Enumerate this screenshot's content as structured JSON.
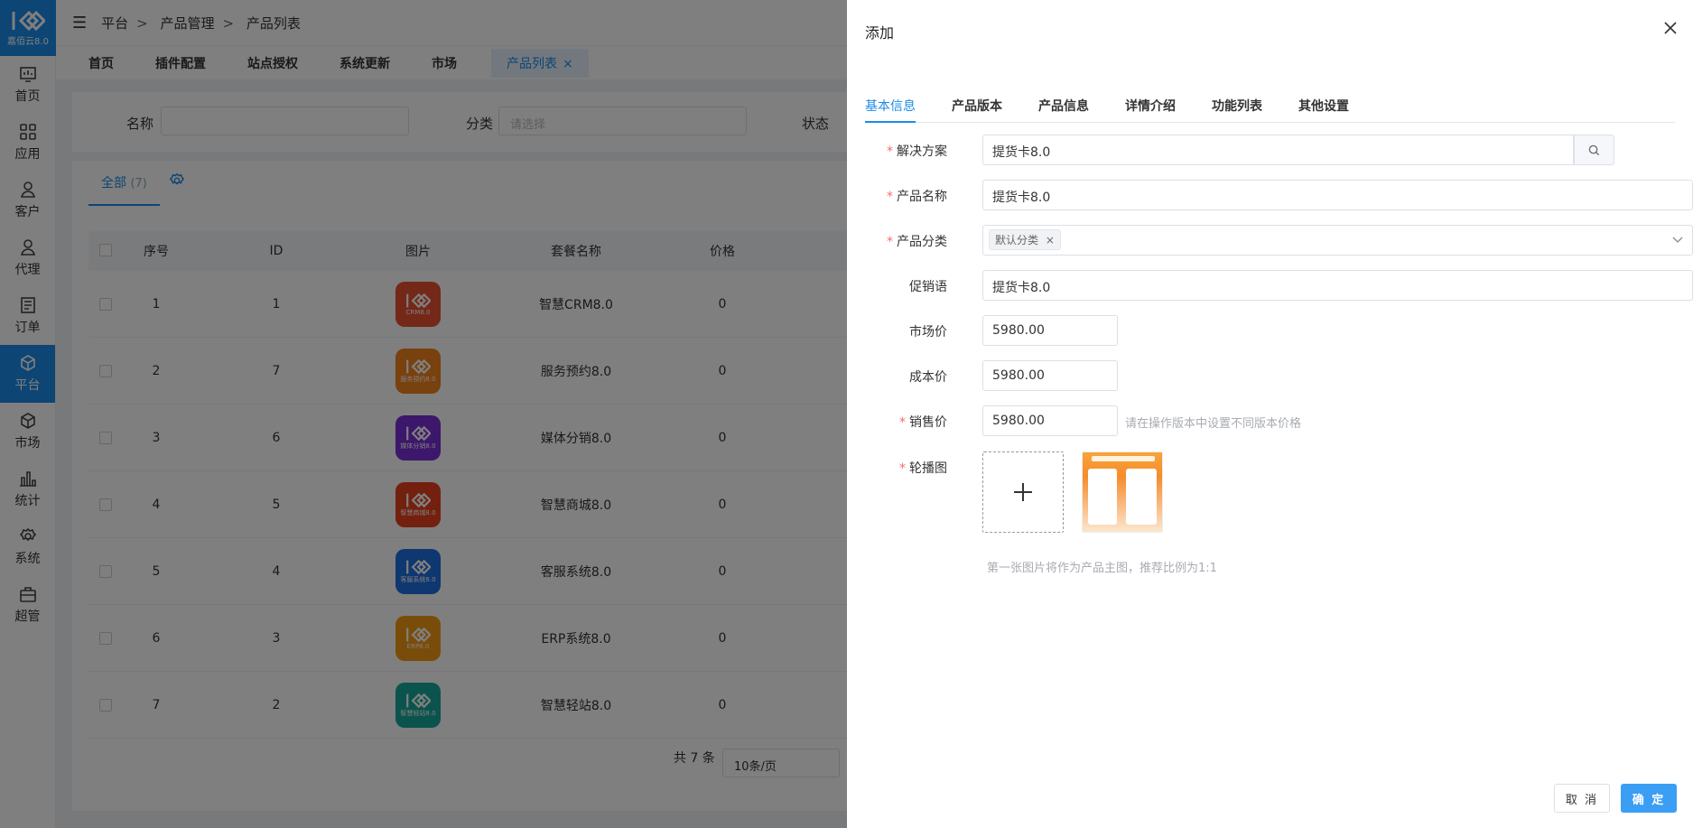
{
  "app": {
    "logo_text": "嘉佰云8.0"
  },
  "sidebar": {
    "items": [
      {
        "label": "首页",
        "icon": "dashboard-icon"
      },
      {
        "label": "应用",
        "icon": "apps-icon"
      },
      {
        "label": "客户",
        "icon": "customer-icon"
      },
      {
        "label": "代理",
        "icon": "agent-icon"
      },
      {
        "label": "订单",
        "icon": "order-icon"
      },
      {
        "label": "平台",
        "icon": "platform-icon",
        "active": true
      },
      {
        "label": "市场",
        "icon": "market-icon"
      },
      {
        "label": "统计",
        "icon": "stats-icon"
      },
      {
        "label": "系统",
        "icon": "settings-icon"
      },
      {
        "label": "超管",
        "icon": "admin-icon"
      }
    ]
  },
  "breadcrumb": [
    "平台",
    "产品管理",
    "产品列表"
  ],
  "page_tabs": [
    "首页",
    "插件配置",
    "站点授权",
    "系统更新",
    "市场",
    "产品列表"
  ],
  "page_tab_close": "×",
  "filter": {
    "name_label": "名称",
    "category_label": "分类",
    "category_placeholder": "请选择",
    "status_label": "状态"
  },
  "table": {
    "subtab_label": "全部",
    "subtab_count": "(7)",
    "headers": [
      "序号",
      "ID",
      "图片",
      "套餐名称",
      "价格"
    ],
    "rows": [
      {
        "no": "1",
        "id": "1",
        "img_text": "CRM8.0",
        "name": "智慧CRM8.0",
        "price": "0",
        "color": "#e8512e"
      },
      {
        "no": "2",
        "id": "7",
        "img_text": "服务预约8.0",
        "name": "服务预约8.0",
        "price": "0",
        "color": "#f0831c"
      },
      {
        "no": "3",
        "id": "6",
        "img_text": "媒体分销8.0",
        "name": "媒体分销8.0",
        "price": "0",
        "color": "#7a2fd6"
      },
      {
        "no": "4",
        "id": "5",
        "img_text": "智慧商城8.0",
        "name": "智慧商城8.0",
        "price": "0",
        "color": "#e6401f"
      },
      {
        "no": "5",
        "id": "4",
        "img_text": "客服系统8.0",
        "name": "客服系统8.0",
        "price": "0",
        "color": "#1f6fe0"
      },
      {
        "no": "6",
        "id": "3",
        "img_text": "ERP8.0",
        "name": "ERP系统8.0",
        "price": "0",
        "color": "#f39a12"
      },
      {
        "no": "7",
        "id": "2",
        "img_text": "智慧轻站8.0",
        "name": "智慧轻站8.0",
        "price": "0",
        "color": "#17a89a"
      }
    ],
    "total": "共 7 条",
    "page_size": "10条/页"
  },
  "drawer": {
    "title": "添加",
    "tabs": [
      "基本信息",
      "产品版本",
      "产品信息",
      "详情介绍",
      "功能列表",
      "其他设置"
    ],
    "fields": {
      "solution_label": "解决方案",
      "solution_value": "提货卡8.0",
      "name_label": "产品名称",
      "name_value": "提货卡8.0",
      "category_label": "产品分类",
      "category_tag": "默认分类",
      "promo_label": "促销语",
      "promo_value": "提货卡8.0",
      "market_price_label": "市场价",
      "market_price_value": "5980.00",
      "cost_price_label": "成本价",
      "cost_price_value": "5980.00",
      "sale_price_label": "销售价",
      "sale_price_value": "5980.00",
      "sale_price_hint": "请在操作版本中设置不同版本价格",
      "carousel_label": "轮播图",
      "carousel_hint": "第一张图片将作为产品主图，推荐比例为1:1"
    },
    "required_mark": "*",
    "cancel_label": "取 消",
    "confirm_label": "确 定"
  },
  "colors": {
    "primary": "#1b8be8",
    "required": "#f56c6c"
  }
}
